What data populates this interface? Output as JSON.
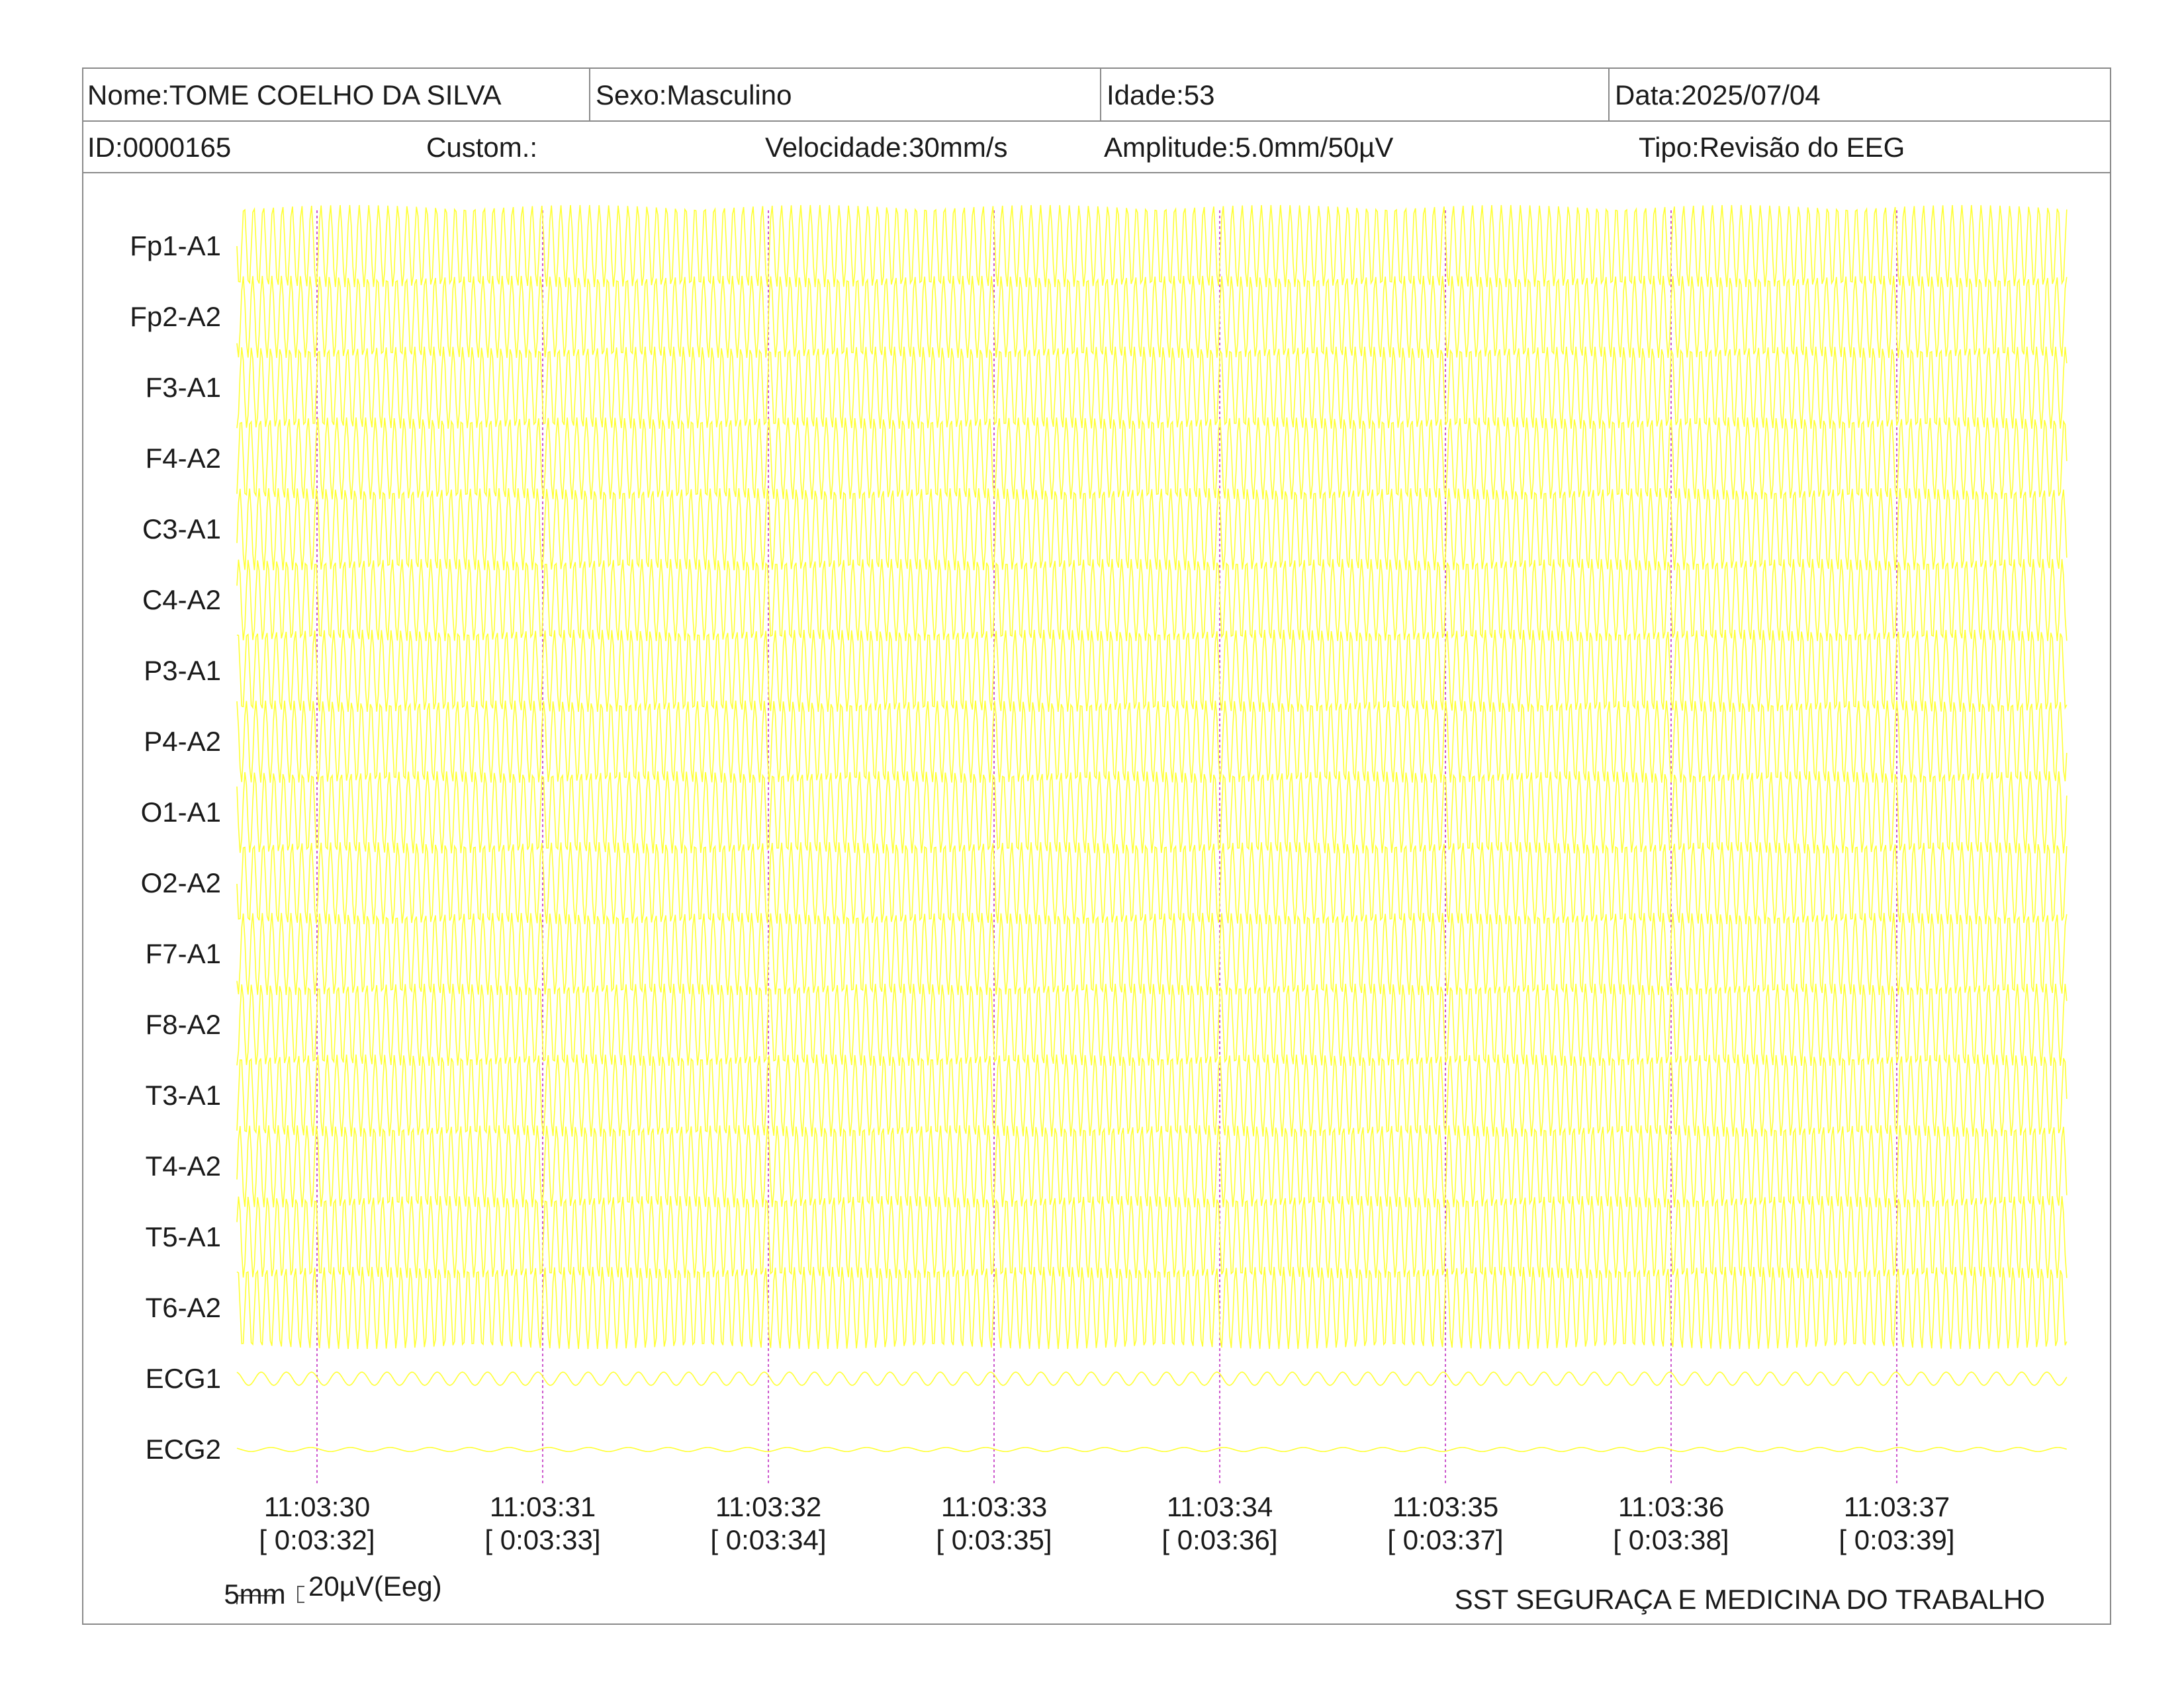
{
  "header": {
    "nome": "Nome:TOME COELHO DA SILVA",
    "sexo": "Sexo:Masculino",
    "idade": "Idade:53",
    "data": "Data:2025/07/04",
    "id": "ID:0000165",
    "custom": "Custom.:",
    "velocidade": "Velocidade:30mm/s",
    "amplitude": "Amplitude:5.0mm/50µV",
    "tipo": "Tipo:Revisão do EEG"
  },
  "colors": {
    "trace": "#ffff33",
    "marker": "#cc55cc",
    "border": "#8a8a8a",
    "text": "#1a1a1a"
  },
  "chart_data": {
    "type": "line",
    "channels": [
      "Fp1-A1",
      "Fp2-A2",
      "F3-A1",
      "F4-A2",
      "C3-A1",
      "C4-A2",
      "P3-A1",
      "P4-A2",
      "O1-A1",
      "O2-A2",
      "F7-A1",
      "F8-A2",
      "T3-A1",
      "T4-A2",
      "T5-A1",
      "T6-A2",
      "ECG1",
      "ECG2"
    ],
    "x_ticks": [
      {
        "time": "11:03:30",
        "elapsed": "[ 0:03:32]"
      },
      {
        "time": "11:03:31",
        "elapsed": "[ 0:03:33]"
      },
      {
        "time": "11:03:32",
        "elapsed": "[ 0:03:34]"
      },
      {
        "time": "11:03:33",
        "elapsed": "[ 0:03:35]"
      },
      {
        "time": "11:03:34",
        "elapsed": "[ 0:03:36]"
      },
      {
        "time": "11:03:35",
        "elapsed": "[ 0:03:37]"
      },
      {
        "time": "11:03:36",
        "elapsed": "[ 0:03:38]"
      },
      {
        "time": "11:03:37",
        "elapsed": "[ 0:03:39]"
      }
    ],
    "grid": false
  },
  "scale": {
    "time_label": "5mm",
    "amp_label": "20µV(Eeg)"
  },
  "footer": "SST SEGURAÇA E MEDICINA DO TRABALHO"
}
